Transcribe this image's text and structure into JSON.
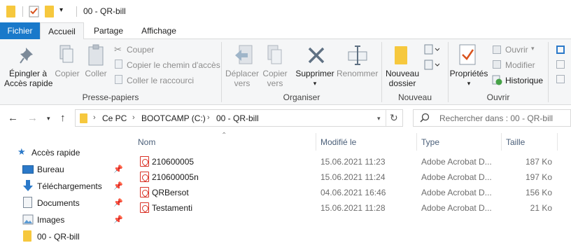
{
  "window": {
    "title": "00 - QR-bill"
  },
  "tabs": [
    {
      "label": "Fichier"
    },
    {
      "label": "Accueil"
    },
    {
      "label": "Partage"
    },
    {
      "label": "Affichage"
    }
  ],
  "ribbon": {
    "clipboard": {
      "group_label": "Presse-papiers",
      "pin_label_1": "Épingler à",
      "pin_label_2": "Accès rapide",
      "copy_label": "Copier",
      "paste_label": "Coller",
      "cut_label": "Couper",
      "copy_path_label": "Copier le chemin d'accès",
      "paste_shortcut_label": "Coller le raccourci"
    },
    "organize": {
      "group_label": "Organiser",
      "move_label_1": "Déplacer",
      "move_label_2": "vers",
      "copyto_label_1": "Copier",
      "copyto_label_2": "vers",
      "delete_label": "Supprimer",
      "rename_label": "Renommer"
    },
    "new": {
      "group_label": "Nouveau",
      "new_folder_label_1": "Nouveau",
      "new_folder_label_2": "dossier"
    },
    "open": {
      "group_label": "Ouvrir",
      "properties_label": "Propriétés",
      "open_label": "Ouvrir",
      "edit_label": "Modifier",
      "history_label": "Historique"
    }
  },
  "address": {
    "crumbs": [
      "Ce PC",
      "BOOTCAMP (C:)",
      "00 - QR-bill"
    ],
    "search_placeholder": "Rechercher dans : 00 - QR-bill"
  },
  "nav": {
    "quick_access": "Accès rapide",
    "items": [
      {
        "label": "Bureau",
        "icon": "desktop-icon",
        "pinned": true
      },
      {
        "label": "Téléchargements",
        "icon": "download-icon",
        "pinned": true
      },
      {
        "label": "Documents",
        "icon": "document-icon",
        "pinned": true
      },
      {
        "label": "Images",
        "icon": "pictures-icon",
        "pinned": true
      },
      {
        "label": "00 - QR-bill",
        "icon": "folder-icon",
        "pinned": false
      }
    ]
  },
  "files": {
    "columns": {
      "name": "Nom",
      "modified": "Modifié le",
      "type": "Type",
      "size": "Taille"
    },
    "rows": [
      {
        "name": "210600005",
        "modified": "15.06.2021 11:23",
        "type": "Adobe Acrobat D...",
        "size": "187 Ko"
      },
      {
        "name": "210600005n",
        "modified": "15.06.2021 11:24",
        "type": "Adobe Acrobat D...",
        "size": "197 Ko"
      },
      {
        "name": "QRBersot",
        "modified": "04.06.2021 16:46",
        "type": "Adobe Acrobat D...",
        "size": "156 Ko"
      },
      {
        "name": "Testamenti",
        "modified": "15.06.2021 11:28",
        "type": "Adobe Acrobat D...",
        "size": "21 Ko"
      }
    ]
  }
}
